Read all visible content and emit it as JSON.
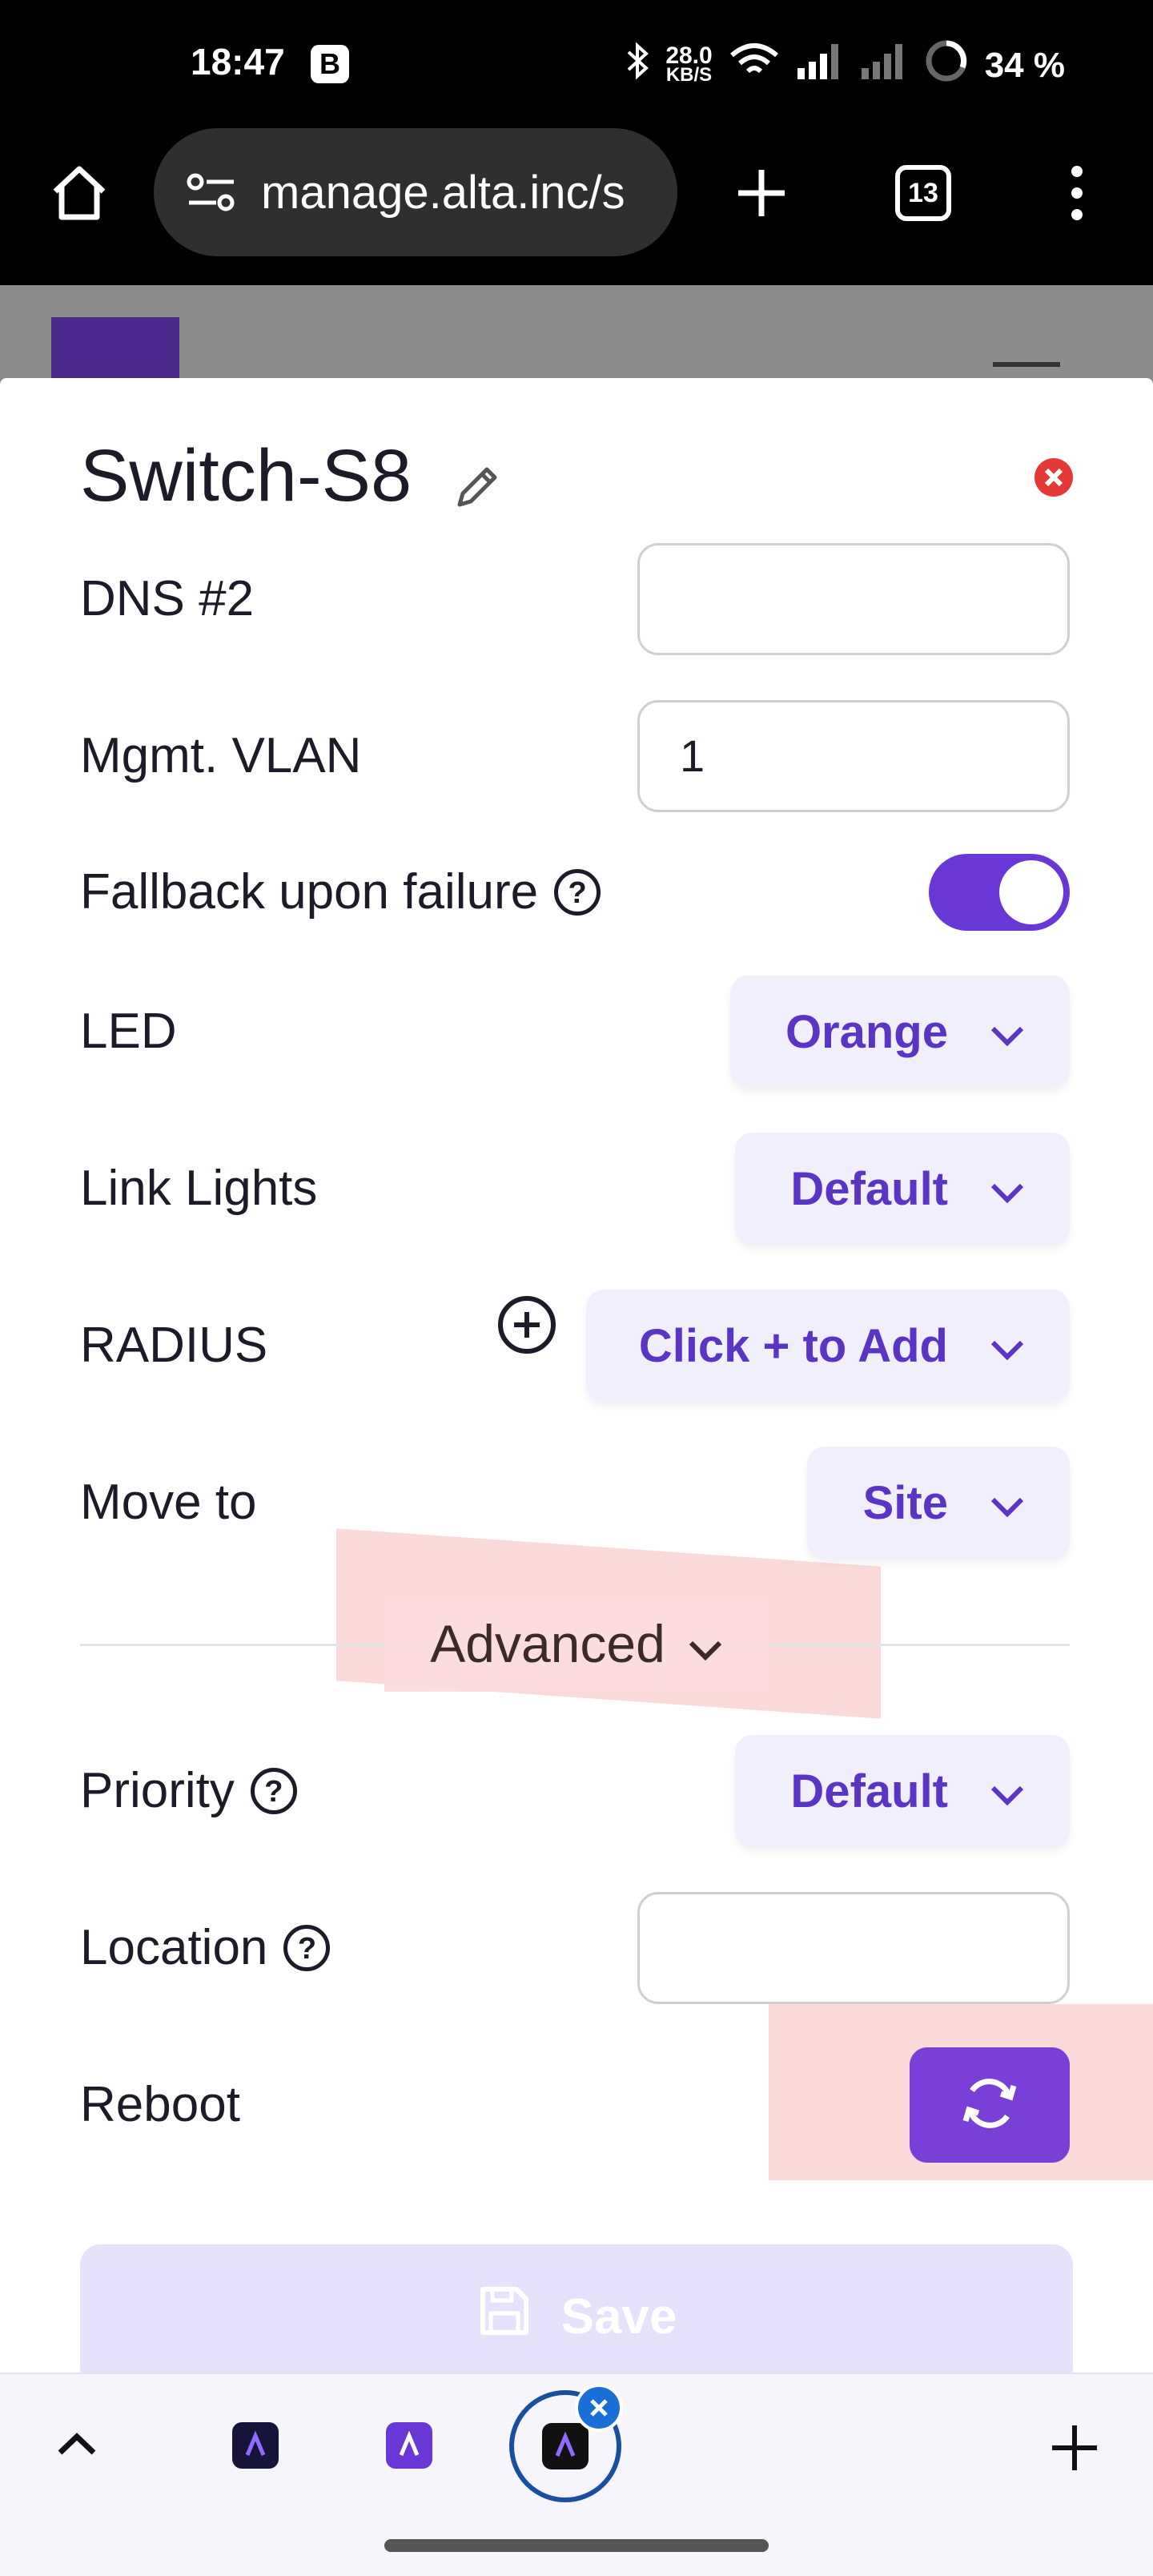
{
  "status_bar": {
    "time": "18:47",
    "badge": "B",
    "net_speed_value": "28.0",
    "net_speed_unit": "KB/S",
    "battery": "34 %"
  },
  "browser": {
    "url": "manage.alta.inc/s",
    "tab_count": "13"
  },
  "modal": {
    "title": "Switch-S8",
    "rows": {
      "dns2_label": "DNS #2",
      "dns2_value": "",
      "vlan_label": "Mgmt. VLAN",
      "vlan_value": "1",
      "fallback_label": "Fallback upon failure",
      "fallback_on": true,
      "led_label": "LED",
      "led_value": "Orange",
      "link_lights_label": "Link Lights",
      "link_lights_value": "Default",
      "radius_label": "RADIUS",
      "radius_value": "Click + to Add",
      "move_to_label": "Move to",
      "move_to_value": "Site",
      "advanced_label": "Advanced",
      "priority_label": "Priority",
      "priority_value": "Default",
      "location_label": "Location",
      "location_value": "",
      "reboot_label": "Reboot"
    },
    "save_label": "Save"
  },
  "colors": {
    "accent": "#6937d6",
    "dropdown_bg": "#f2effd",
    "dropdown_text": "#5a34c4",
    "close_red": "#e53935"
  }
}
